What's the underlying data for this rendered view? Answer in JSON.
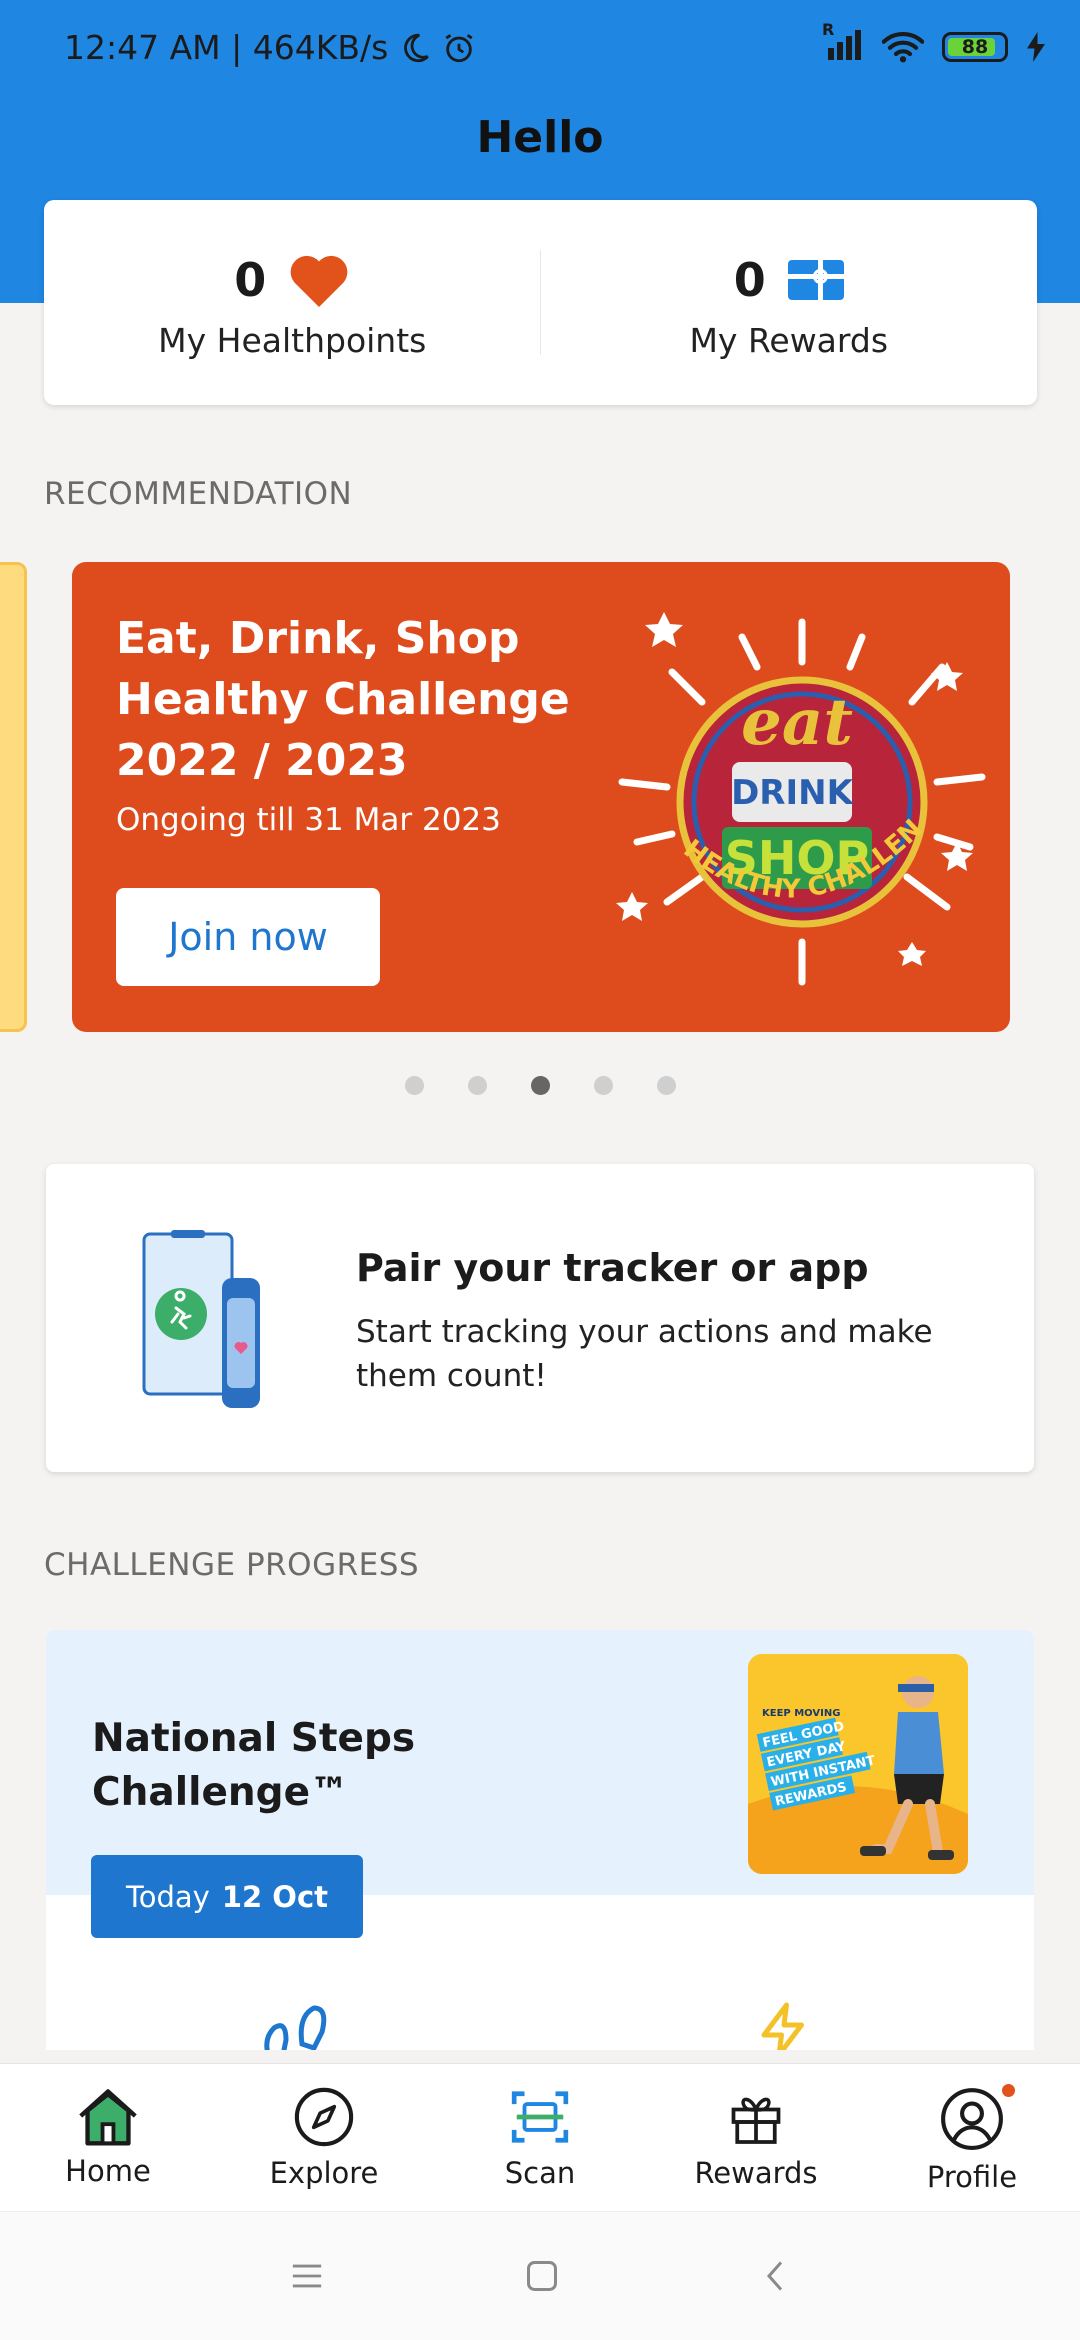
{
  "status_bar": {
    "time": "12:47 AM | 464KB/s",
    "network_label": "R",
    "battery": "88"
  },
  "header": {
    "title": "Hello"
  },
  "summary": {
    "healthpoints_value": "0",
    "healthpoints_label": "My Healthpoints",
    "rewards_value": "0",
    "rewards_label": "My Rewards",
    "heart_color": "#e2531c",
    "gift_color": "#1f86e2"
  },
  "recommendation": {
    "section_title": "RECOMMENDATION",
    "card": {
      "title": "Eat, Drink, Shop Healthy Challenge 2022 / 2023",
      "subtitle": "Ongoing till 31 Mar 2023",
      "button_label": "Join now",
      "background": "#de4c1e",
      "logo_words": [
        "eat",
        "DRINK",
        "SHOP",
        "HEALTHY CHALLENGE"
      ]
    },
    "pagination": {
      "total": 5,
      "active_index": 2
    }
  },
  "pair_tracker": {
    "title": "Pair your tracker or app",
    "description": "Start tracking your actions and make them count!"
  },
  "challenge_progress": {
    "section_title": "CHALLENGE PROGRESS",
    "challenge_title": "National Steps Challenge™",
    "today_label": "Today",
    "today_date": "12 Oct",
    "image_text": [
      "KEEP MOVING",
      "FEEL GOOD",
      "EVERY DAY",
      "WITH INSTANT",
      "REWARDS"
    ]
  },
  "bottom_nav": {
    "items": [
      {
        "label": "Home",
        "icon": "home-icon",
        "active": true
      },
      {
        "label": "Explore",
        "icon": "compass-icon"
      },
      {
        "label": "Scan",
        "icon": "scan-icon"
      },
      {
        "label": "Rewards",
        "icon": "gift-icon"
      },
      {
        "label": "Profile",
        "icon": "profile-icon",
        "has_notification": true
      }
    ]
  },
  "system_nav": {
    "buttons": [
      "menu-icon",
      "home-square-icon",
      "back-icon"
    ]
  }
}
